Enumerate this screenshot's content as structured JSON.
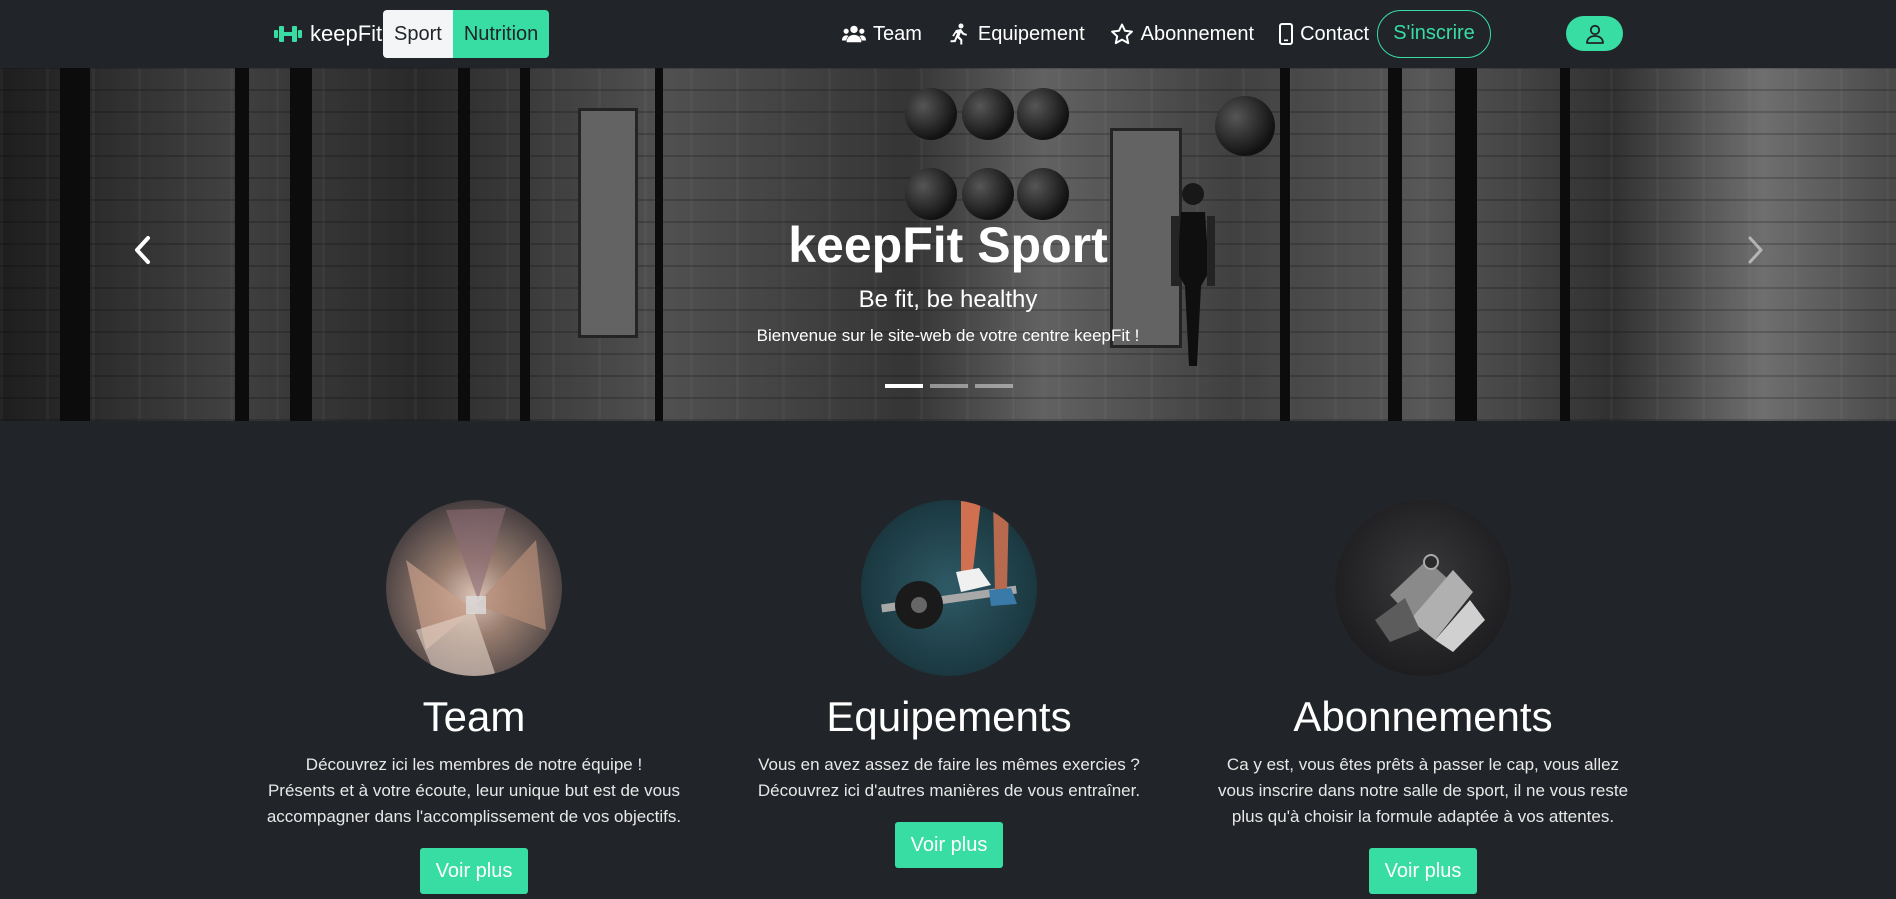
{
  "nav": {
    "brand": "keepFit",
    "segments": [
      "Sport",
      "Nutrition"
    ],
    "links": [
      {
        "label": "Team",
        "icon": "users-icon"
      },
      {
        "label": "Equipement",
        "icon": "running-icon"
      },
      {
        "label": "Abonnement",
        "icon": "star-icon"
      },
      {
        "label": "Contact",
        "icon": "mobile-icon"
      }
    ],
    "signup": "S'inscrire",
    "user_icon": "user-icon"
  },
  "hero": {
    "title": "keepFit Sport",
    "subtitle": "Be fit, be healthy",
    "text": "Bienvenue sur le site-web de votre centre keepFit !",
    "slides": 3,
    "active_slide": 0
  },
  "features": [
    {
      "title": "Team",
      "lines": [
        "Découvrez ici les membres de notre équipe !",
        "Présents et à votre écoute, leur unique but est de vous",
        "accompagner dans l'accomplissement de vos objectifs."
      ],
      "button": "Voir plus"
    },
    {
      "title": "Equipements",
      "lines": [
        "Vous en avez assez de faire les mêmes exercies ?",
        "Découvrez ici d'autres manières de vous entraîner."
      ],
      "button": "Voir plus"
    },
    {
      "title": "Abonnements",
      "lines": [
        "Ca y est, vous êtes prêts à passer le cap, vous allez",
        "vous inscrire dans notre salle de sport, il ne vous reste",
        "plus qu'à choisir la formule adaptée à vos attentes."
      ],
      "button": "Voir plus"
    }
  ],
  "colors": {
    "background": "#212428",
    "accent": "#38dda3",
    "light": "#f4f5f6"
  }
}
